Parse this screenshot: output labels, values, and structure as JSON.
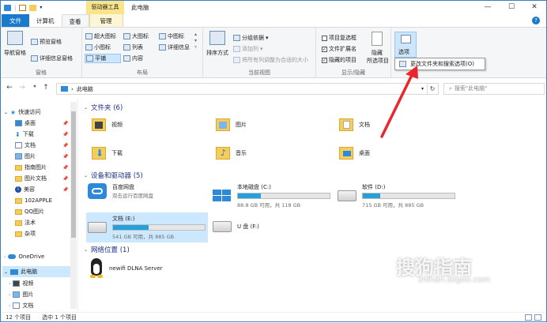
{
  "title_bar": {
    "context_title": "驱动器工具",
    "window_title": "此电脑",
    "minimize": "—",
    "maximize": "☐",
    "close": "✕"
  },
  "tabs": [
    "文件",
    "计算机",
    "查看",
    "管理"
  ],
  "ribbon": {
    "pane": {
      "nav_pane": "导航窗格",
      "preview_pane": "预览窗格",
      "details_pane": "详细信息窗格",
      "label": "窗格"
    },
    "layout": {
      "items": [
        "超大图标",
        "大图标",
        "中图标",
        "小图标",
        "列表",
        "详细信息",
        "平铺",
        "内容"
      ],
      "label": "布局"
    },
    "current_view": {
      "sort": "排序方式",
      "group_by": "分组依据",
      "add_column": "添加列",
      "fit_columns": "将所有列调整为合适的大小",
      "label": "当前视图"
    },
    "show_hide": {
      "item_checkbox": "项目复选框",
      "extensions": "文件扩展名",
      "hidden_items": "隐藏的项目",
      "hide_selected": "隐藏",
      "hide_selected2": "所选项目",
      "label": "显示/隐藏"
    },
    "options": {
      "label": "选项"
    }
  },
  "context_menu": {
    "item": "更改文件夹和搜索选项(O)"
  },
  "address": {
    "path": "此电脑",
    "search_placeholder": "搜索\"此电脑\""
  },
  "nav_pane": {
    "quick_access": "快速访问",
    "items": [
      "桌面",
      "下载",
      "文档",
      "图片",
      "指南图片",
      "图片文档",
      "美容",
      "102APPLE",
      "QQ图片",
      "法术",
      "杂项"
    ],
    "onedrive": "OneDrive",
    "this_pc": "此电脑",
    "pc_items": [
      "视频",
      "图片",
      "文档"
    ]
  },
  "content": {
    "folders_header": "文件夹 (6)",
    "folders": [
      "视频",
      "图片",
      "文档",
      "下载",
      "音乐",
      "桌面"
    ],
    "devices_header": "设备和驱动器 (5)",
    "devices": [
      {
        "name": "百度网盘",
        "sub": "双击运行百度网盘"
      },
      {
        "name": "本地磁盘 (C:)",
        "sub": "88.8 GB 可用，共 118 GB",
        "used": 0.25
      },
      {
        "name": "软件 (D:)",
        "sub": "715 GB 可用，共 885 GB",
        "used": 0.19
      },
      {
        "name": "文档 (E:)",
        "sub": "541 GB 可用，共 885 GB",
        "used": 0.39
      },
      {
        "name": "U 盘 (F:)",
        "sub": ""
      }
    ],
    "network_header": "网络位置 (1)",
    "network": [
      "newifi DLNA Server"
    ]
  },
  "status": {
    "count": "12 个项目",
    "selected": "选中 1 个项目"
  },
  "watermark": {
    "text": "搜狗指南",
    "url": "zhinan.sogou.com"
  },
  "colors": {
    "accent": "#1979ca",
    "arrow": "#e8262b",
    "bar": "#26a0da",
    "drive_tools": "#f9e489"
  }
}
